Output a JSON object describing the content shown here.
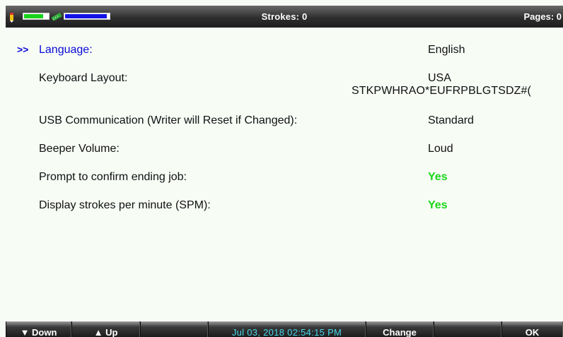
{
  "status_bar": {
    "strokes": "Strokes: 0",
    "pages": "Pages: 0",
    "battery_level": 0.8,
    "memory_level": 0.95
  },
  "settings": [
    {
      "label": "Language:",
      "value": "English",
      "selected": true
    },
    {
      "label": "Keyboard Layout:",
      "value": "USA",
      "extra": "STKPWHRAO*EUFRPBLGTSDZ#("
    },
    {
      "label": "USB Communication (Writer will Reset if Changed):",
      "value": "Standard"
    },
    {
      "label": "Beeper Volume:",
      "value": "Loud"
    },
    {
      "label": "Prompt to confirm ending job:",
      "value": "Yes"
    },
    {
      "label": "Display strokes per minute (SPM):",
      "value": "Yes"
    }
  ],
  "cursor": ">>",
  "softkeys": {
    "down": "▼ Down",
    "up": "▲ Up",
    "blank1": "",
    "datetime": "Jul 03, 2018  02:54:15 PM",
    "change": "Change",
    "blank2": "",
    "ok": "OK"
  },
  "colors": {
    "selected": "#0a0ad8",
    "yes_value": "#1bd61b",
    "battery": "#19d21b",
    "memory": "#1313e6",
    "date_text": "#48d8ec"
  }
}
